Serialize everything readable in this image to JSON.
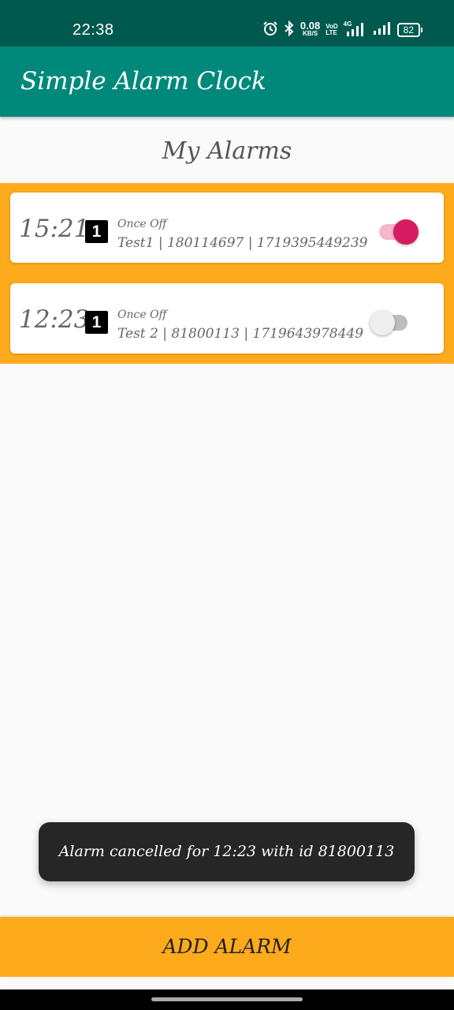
{
  "status_bar": {
    "time": "22:38",
    "net_speed_value": "0.08",
    "net_speed_unit": "KB/S",
    "volte_top": "VoD",
    "volte_bottom": "LTE",
    "network_label": "4G",
    "battery": "82"
  },
  "app_bar": {
    "title": "Simple Alarm Clock"
  },
  "page": {
    "heading": "My Alarms"
  },
  "alarms": [
    {
      "time": "15:21",
      "badge": "1",
      "repeat": "Once Off",
      "detail": "Test1 | 180114697 | 1719395449239",
      "enabled": true
    },
    {
      "time": "12:23",
      "badge": "1",
      "repeat": "Once Off",
      "detail": "Test 2 | 81800113 | 1719643978449",
      "enabled": false
    }
  ],
  "toast": {
    "message": "Alarm cancelled for 12:23 with id 81800113"
  },
  "footer": {
    "add_alarm_label": "ADD ALARM"
  },
  "colors": {
    "status_bar": "#00594f",
    "app_bar": "#00897b",
    "accent": "#fdab1d",
    "toggle_on": "#d81b60"
  }
}
